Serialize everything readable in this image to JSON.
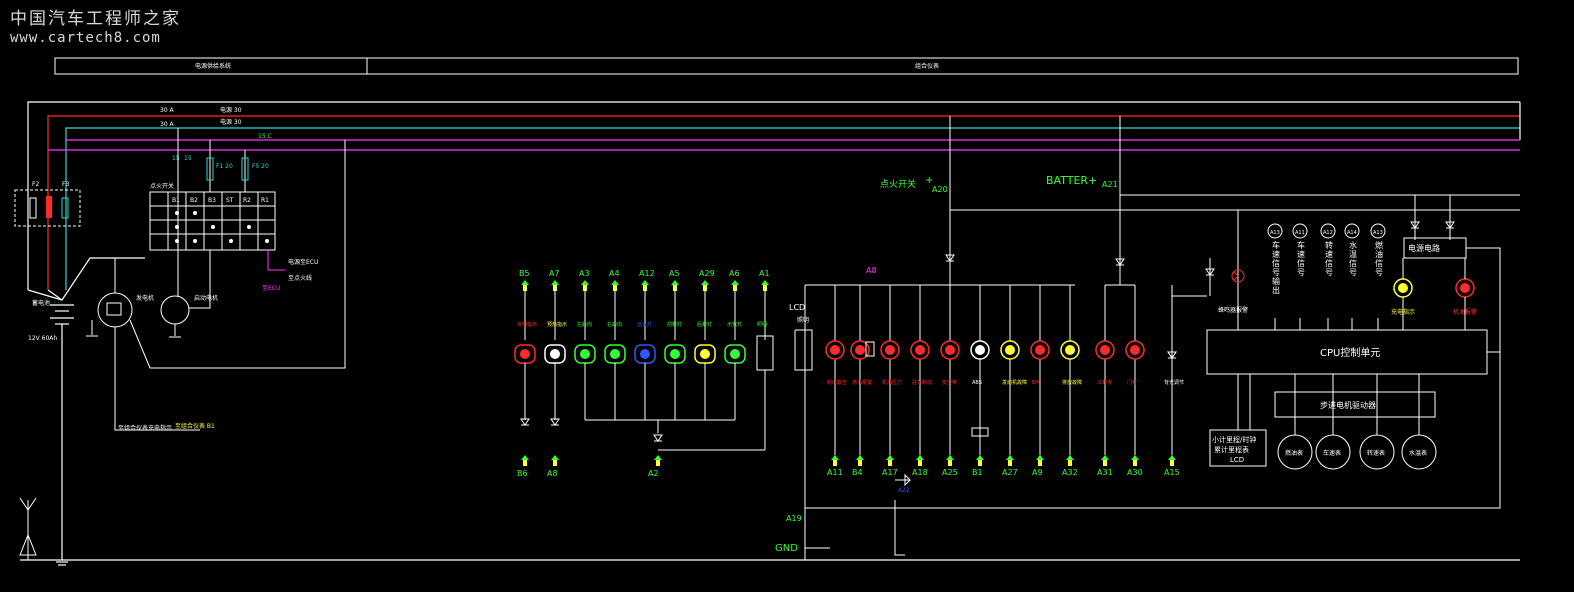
{
  "watermark": {
    "line1": "中国汽车工程师之家",
    "line2": "www.cartech8.com"
  },
  "colors": {
    "bg": "#000000",
    "wire_white": "#ffffff",
    "wire_red": "#ff2a2a",
    "wire_cyan": "#33d6d6",
    "wire_magenta": "#ff33ff",
    "wire_green": "#33ff33",
    "label_yellow": "#ffff33",
    "label_red": "#ff3333",
    "label_green": "#33ff33",
    "label_blue": "#3355ff"
  },
  "header": {
    "left": "电源供给系统",
    "right": "组合仪表"
  },
  "supply": {
    "bus_top": [
      "30  A",
      "30  A",
      "电源 30",
      "电源 30"
    ],
    "ign_labels": [
      "15",
      "15",
      "F1 20",
      "F5 20",
      "15  C"
    ],
    "fuse_box_labels": [
      "F2",
      "F3"
    ]
  },
  "ignition_switch": {
    "title": "点火开关",
    "columns": [
      "B1",
      "B2",
      "B3",
      "ST",
      "R2",
      "R1"
    ]
  },
  "components": {
    "battery": "蓄电池",
    "battery_spec": "12V 60Ah",
    "alternator": "发电机",
    "starter": "启动电机",
    "to_ecu": "至ECU",
    "to_meter1": "至组合仪表充电指示",
    "to_meter2": "至组合仪表 B1",
    "to_ign1": "电源至ECU",
    "to_ign2": "至点火线"
  },
  "top_labels": {
    "ign_switch": "点火开关",
    "ign_plus": "+",
    "a20": "A20",
    "batter": "BATTER+",
    "a21": "A21",
    "a8": "A8",
    "lcd": "LCD",
    "lcd_sub": "照明",
    "ground": "GND",
    "a19": "A19",
    "a9": "A9",
    "a16": "A16",
    "a22": "A22"
  },
  "upper_pins": [
    {
      "pin": "B5",
      "label": "充电指示"
    },
    {
      "pin": "A7",
      "label": "预热指示"
    },
    {
      "pin": "A3",
      "label": "左转向"
    },
    {
      "pin": "A4",
      "label": "右转向"
    },
    {
      "pin": "A12",
      "label": "远光灯"
    },
    {
      "pin": "A5",
      "label": "前雾灯"
    },
    {
      "pin": "A29",
      "label": "后雾灯"
    },
    {
      "pin": "A6",
      "label": "示宽灯"
    },
    {
      "pin": "A1",
      "label": "照明"
    }
  ],
  "lower_pins_left": [
    "B6",
    "A8",
    "A2"
  ],
  "lamp_colors": [
    "#ff2a2a",
    "#ffffff",
    "#33ff33",
    "#33ff33",
    "#3355ff",
    "#33ff33",
    "#ffff33",
    "#33ff33"
  ],
  "ctrl_group": [
    {
      "pin": "A11",
      "label": "制动警告",
      "color": "#ff2a2a"
    },
    {
      "pin": "B4",
      "label": "燃油报警",
      "color": "#ff2a2a"
    },
    {
      "pin": "A17",
      "label": "机油压力",
      "color": "#ff2a2a"
    },
    {
      "pin": "A18",
      "label": "驻车制动",
      "color": "#ff2a2a"
    },
    {
      "pin": "A25",
      "label": "安全带",
      "color": "#ff2a2a"
    },
    {
      "pin": "B1",
      "label": "ABS",
      "color": "#ffffff"
    },
    {
      "pin": "A27",
      "label": "发动机故障",
      "color": "#ffff33"
    },
    {
      "pin": "A9",
      "label": "EPC",
      "color": "#ff2a2a"
    },
    {
      "pin": "A32",
      "label": "排放故障",
      "color": "#ffff33"
    },
    {
      "pin": "A31",
      "label": "冷却液",
      "color": "#ff2a2a"
    },
    {
      "pin": "A30",
      "label": "门开",
      "color": "#ff2a2a"
    },
    {
      "pin": "A15",
      "label": "背光调节"
    }
  ],
  "cpu": {
    "label": "CPU控制单元",
    "driver": "步进电机驱动器",
    "power": "电源电路",
    "lcd_box": [
      "小计里程/时钟",
      "累计里程表",
      "LCD"
    ],
    "signals": [
      {
        "sym": "A13",
        "label": "车速信号输出"
      },
      {
        "sym": "A11",
        "label": "车速信号"
      },
      {
        "sym": "A12",
        "label": "转速信号"
      },
      {
        "sym": "A14",
        "label": "水温信号"
      },
      {
        "sym": "A13",
        "label": "燃油信号"
      }
    ],
    "gauges": [
      "燃油表",
      "车速表",
      "转速表",
      "水温表"
    ],
    "buzzer_label": "蜂鸣器报警",
    "right_lamps": [
      "充电指示",
      "机油报警"
    ]
  }
}
